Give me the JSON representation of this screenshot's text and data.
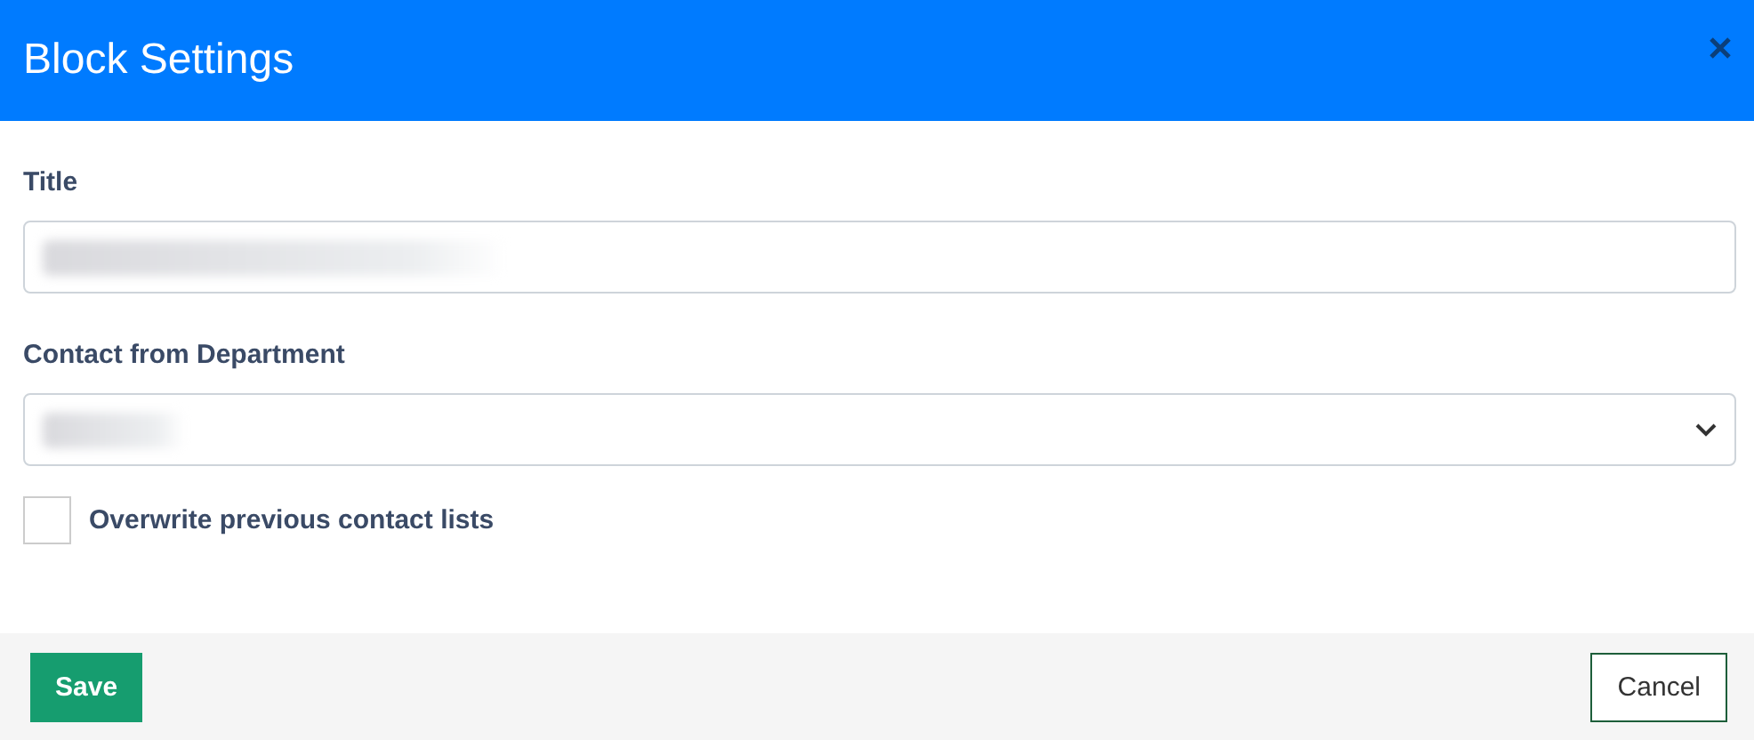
{
  "dialog": {
    "title": "Block Settings"
  },
  "fields": [
    {
      "kind": "text",
      "label": "Title"
    },
    {
      "kind": "select",
      "label": "Contact from Department"
    }
  ],
  "checkbox": {
    "label": "Overwrite previous contact lists",
    "checked": false
  },
  "buttons": [
    {
      "kind": "primary",
      "label": "Save"
    },
    {
      "kind": "secondary",
      "label": "Cancel"
    }
  ]
}
